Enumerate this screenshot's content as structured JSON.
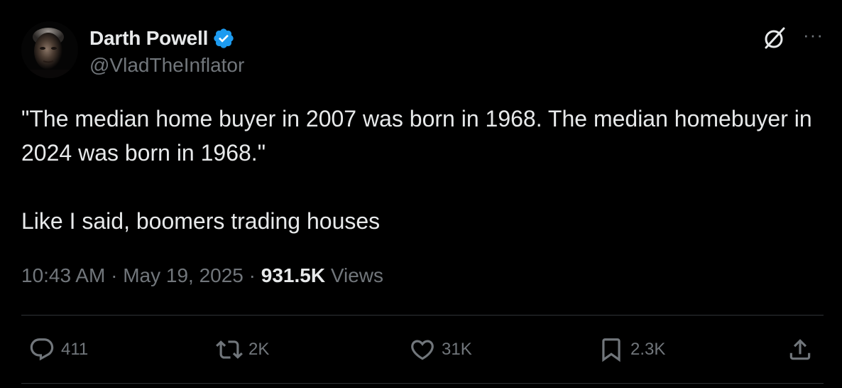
{
  "author": {
    "display_name": "Darth Powell",
    "handle": "@VladTheInflator",
    "verified": true,
    "verified_color": "#1d9bf0"
  },
  "header_actions": {
    "grok_icon": "grok-icon",
    "more_label": "···"
  },
  "tweet": {
    "line1": "\"The median home buyer in 2007 was born in 1968. The median homebuyer in 2024 was born in 1968.\"",
    "line2": "Like I said, boomers trading houses"
  },
  "meta": {
    "time": "10:43 AM",
    "separator": " · ",
    "date": "May 19, 2025",
    "views_count": "931.5K",
    "views_label": " Views"
  },
  "actions": {
    "reply_count": "411",
    "retweet_count": "2K",
    "like_count": "31K",
    "bookmark_count": "2.3K"
  },
  "colors": {
    "background": "#000000",
    "text_primary": "#e7e9ea",
    "text_secondary": "#71767b",
    "divider": "#2f3336"
  }
}
